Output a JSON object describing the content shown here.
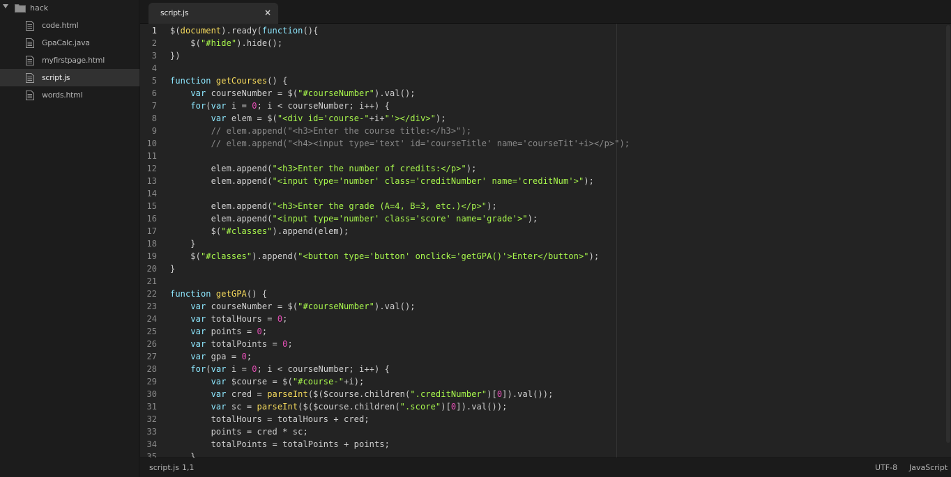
{
  "sidebar": {
    "folder_label": "hack",
    "folder_icon": "folder-icon",
    "files": [
      {
        "name": "code.html",
        "icon": "file-icon",
        "active": false
      },
      {
        "name": "GpaCalc.java",
        "icon": "file-icon",
        "active": false
      },
      {
        "name": "myfirstpage.html",
        "icon": "file-icon",
        "active": false
      },
      {
        "name": "script.js",
        "icon": "file-icon",
        "active": true
      },
      {
        "name": "words.html",
        "icon": "file-icon",
        "active": false
      }
    ]
  },
  "tab": {
    "label": "script.js",
    "close": "×"
  },
  "editor": {
    "current_line": 1,
    "colors": {
      "keyword": "#8ee8ff",
      "string": "#a7f54c",
      "number": "#e44fb5",
      "function": "#f4d95c",
      "comment": "#8a8a8a",
      "text": "#d0d0d0"
    },
    "lines": [
      [
        [
          "t",
          "$("
        ],
        [
          "f",
          "document"
        ],
        [
          "t",
          ").ready("
        ],
        [
          "k",
          "function"
        ],
        [
          "t",
          "(){"
        ]
      ],
      [
        [
          "t",
          "    $("
        ],
        [
          "s",
          "\"#hide\""
        ],
        [
          "t",
          ").hide();"
        ]
      ],
      [
        [
          "t",
          "})"
        ]
      ],
      [],
      [
        [
          "k",
          "function "
        ],
        [
          "f",
          "getCourses"
        ],
        [
          "t",
          "() {"
        ]
      ],
      [
        [
          "t",
          "    "
        ],
        [
          "k",
          "var"
        ],
        [
          "t",
          " courseNumber = $("
        ],
        [
          "s",
          "\"#courseNumber\""
        ],
        [
          "t",
          ").val();"
        ]
      ],
      [
        [
          "t",
          "    "
        ],
        [
          "k",
          "for"
        ],
        [
          "t",
          "("
        ],
        [
          "k",
          "var"
        ],
        [
          "t",
          " i = "
        ],
        [
          "n",
          "0"
        ],
        [
          "t",
          "; i < courseNumber; i++) {"
        ]
      ],
      [
        [
          "t",
          "        "
        ],
        [
          "k",
          "var"
        ],
        [
          "t",
          " elem = $("
        ],
        [
          "s",
          "\"<div id='course-\""
        ],
        [
          "t",
          "+i+"
        ],
        [
          "s",
          "\"'></div>\""
        ],
        [
          "t",
          ");"
        ]
      ],
      [
        [
          "c",
          "        // elem.append(\"<h3>Enter the course title:</h3>\");"
        ]
      ],
      [
        [
          "c",
          "        // elem.append(\"<h4><input type='text' id='courseTitle' name='courseTit'+i></p>\");"
        ]
      ],
      [],
      [
        [
          "t",
          "        elem.append("
        ],
        [
          "s",
          "\"<h3>Enter the number of credits:</p>\""
        ],
        [
          "t",
          ");"
        ]
      ],
      [
        [
          "t",
          "        elem.append("
        ],
        [
          "s",
          "\"<input type='number' class='creditNumber' name='creditNum'>\""
        ],
        [
          "t",
          ");"
        ]
      ],
      [],
      [
        [
          "t",
          "        elem.append("
        ],
        [
          "s",
          "\"<h3>Enter the grade (A=4, B=3, etc.)</p>\""
        ],
        [
          "t",
          ");"
        ]
      ],
      [
        [
          "t",
          "        elem.append("
        ],
        [
          "s",
          "\"<input type='number' class='score' name='grade'>\""
        ],
        [
          "t",
          ");"
        ]
      ],
      [
        [
          "t",
          "        $("
        ],
        [
          "s",
          "\"#classes\""
        ],
        [
          "t",
          ").append(elem);"
        ]
      ],
      [
        [
          "t",
          "    }"
        ]
      ],
      [
        [
          "t",
          "    $("
        ],
        [
          "s",
          "\"#classes\""
        ],
        [
          "t",
          ").append("
        ],
        [
          "s",
          "\"<button type='button' onclick='getGPA()'>Enter</button>\""
        ],
        [
          "t",
          ");"
        ]
      ],
      [
        [
          "t",
          "}"
        ]
      ],
      [],
      [
        [
          "k",
          "function "
        ],
        [
          "f",
          "getGPA"
        ],
        [
          "t",
          "() {"
        ]
      ],
      [
        [
          "t",
          "    "
        ],
        [
          "k",
          "var"
        ],
        [
          "t",
          " courseNumber = $("
        ],
        [
          "s",
          "\"#courseNumber\""
        ],
        [
          "t",
          ").val();"
        ]
      ],
      [
        [
          "t",
          "    "
        ],
        [
          "k",
          "var"
        ],
        [
          "t",
          " totalHours = "
        ],
        [
          "n",
          "0"
        ],
        [
          "t",
          ";"
        ]
      ],
      [
        [
          "t",
          "    "
        ],
        [
          "k",
          "var"
        ],
        [
          "t",
          " points = "
        ],
        [
          "n",
          "0"
        ],
        [
          "t",
          ";"
        ]
      ],
      [
        [
          "t",
          "    "
        ],
        [
          "k",
          "var"
        ],
        [
          "t",
          " totalPoints = "
        ],
        [
          "n",
          "0"
        ],
        [
          "t",
          ";"
        ]
      ],
      [
        [
          "t",
          "    "
        ],
        [
          "k",
          "var"
        ],
        [
          "t",
          " gpa = "
        ],
        [
          "n",
          "0"
        ],
        [
          "t",
          ";"
        ]
      ],
      [
        [
          "t",
          "    "
        ],
        [
          "k",
          "for"
        ],
        [
          "t",
          "("
        ],
        [
          "k",
          "var"
        ],
        [
          "t",
          " i = "
        ],
        [
          "n",
          "0"
        ],
        [
          "t",
          "; i < courseNumber; i++) {"
        ]
      ],
      [
        [
          "t",
          "        "
        ],
        [
          "k",
          "var"
        ],
        [
          "t",
          " $course = $("
        ],
        [
          "s",
          "\"#course-\""
        ],
        [
          "t",
          "+i);"
        ]
      ],
      [
        [
          "t",
          "        "
        ],
        [
          "k",
          "var"
        ],
        [
          "t",
          " cred = "
        ],
        [
          "f",
          "parseInt"
        ],
        [
          "t",
          "($($course.children("
        ],
        [
          "s",
          "\".creditNumber\""
        ],
        [
          "t",
          ")["
        ],
        [
          "n",
          "0"
        ],
        [
          "t",
          "]).val());"
        ]
      ],
      [
        [
          "t",
          "        "
        ],
        [
          "k",
          "var"
        ],
        [
          "t",
          " sc = "
        ],
        [
          "f",
          "parseInt"
        ],
        [
          "t",
          "($($course.children("
        ],
        [
          "s",
          "\".score\""
        ],
        [
          "t",
          ")["
        ],
        [
          "n",
          "0"
        ],
        [
          "t",
          "]).val());"
        ]
      ],
      [
        [
          "t",
          "        totalHours = totalHours + cred;"
        ]
      ],
      [
        [
          "t",
          "        points = cred * sc;"
        ]
      ],
      [
        [
          "t",
          "        totalPoints = totalPoints + points;"
        ]
      ],
      [
        [
          "t",
          "    }"
        ]
      ]
    ]
  },
  "status": {
    "file": "script.js",
    "position": "1,1",
    "encoding": "UTF-8",
    "syntax": "JavaScript"
  }
}
